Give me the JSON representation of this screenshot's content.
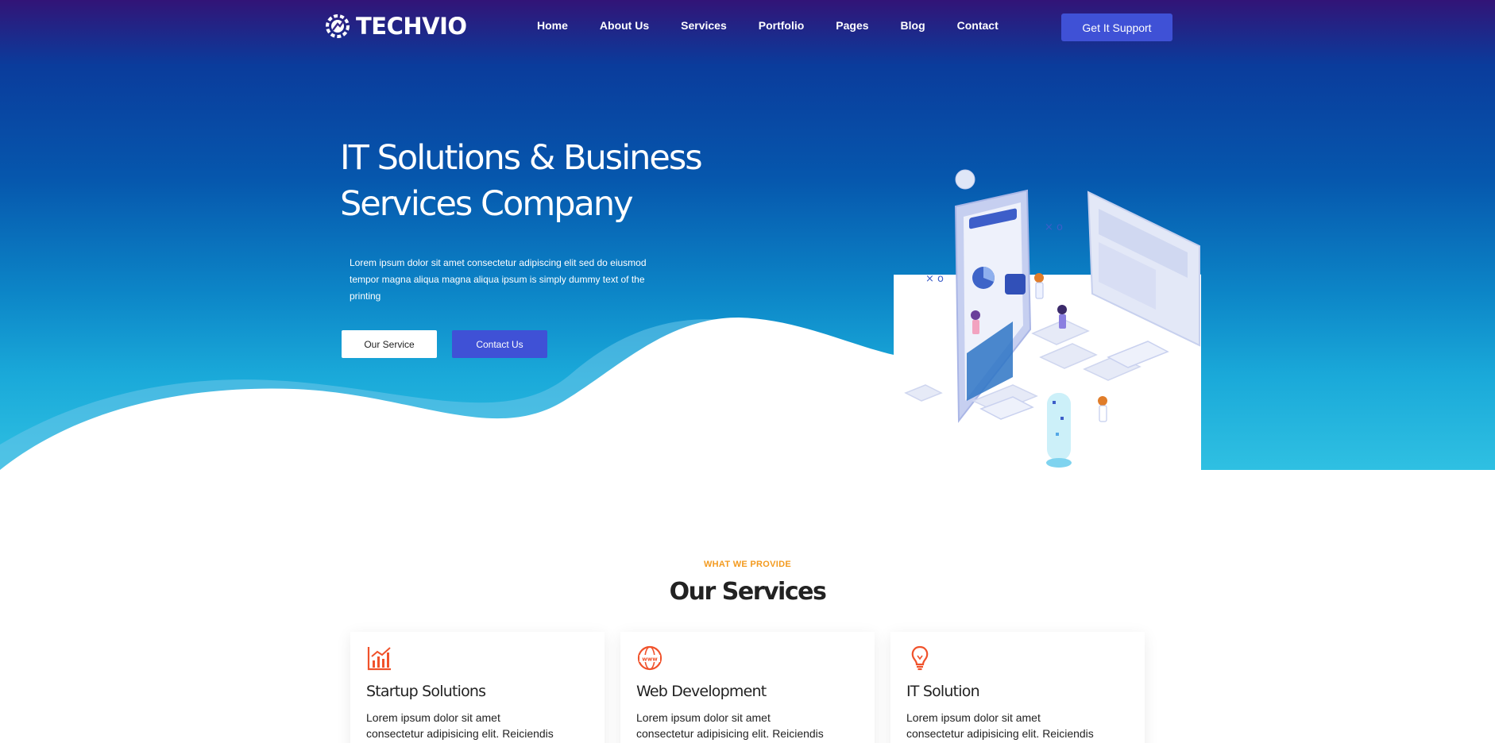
{
  "brand": {
    "name": "TECHVIO",
    "logo_icon": "gear-shield-logo-icon"
  },
  "nav": {
    "items": [
      {
        "label": "Home"
      },
      {
        "label": "About Us"
      },
      {
        "label": "Services"
      },
      {
        "label": "Portfolio"
      },
      {
        "label": "Pages"
      },
      {
        "label": "Blog"
      },
      {
        "label": "Contact"
      }
    ],
    "cta_label": "Get It Support"
  },
  "hero": {
    "title_line1": "IT Solutions & Business",
    "title_line2": "Services Company",
    "description": "Lorem ipsum dolor sit amet consectetur adipiscing elit sed do eiusmod tempor magna aliqua magna aliqua ipsum is simply dummy text of the printing",
    "primary_button": "Our Service",
    "secondary_button": "Contact Us",
    "illustration": "isometric-mobile-app-illustration"
  },
  "services": {
    "kicker": "WHAT WE PROVIDE",
    "title": "Our Services",
    "cards": [
      {
        "icon": "chart-growth-icon",
        "title": "Startup Solutions",
        "text": "Lorem ipsum dolor sit amet consectetur adipisicing elit. Reiciendis error et tenetur"
      },
      {
        "icon": "globe-www-icon",
        "title": "Web Development",
        "text": "Lorem ipsum dolor sit amet consectetur adipisicing elit. Reiciendis error et tenetur"
      },
      {
        "icon": "lightbulb-icon",
        "title": "IT Solution",
        "text": "Lorem ipsum dolor sit amet consectetur adipisicing elit. Reiciendis error et tenetur"
      }
    ]
  },
  "colors": {
    "accent": "#3f51d6",
    "kicker": "#f39a1e",
    "icon": "#f0522b",
    "hero_top": "#321477",
    "hero_bottom": "#2fc0e2"
  }
}
